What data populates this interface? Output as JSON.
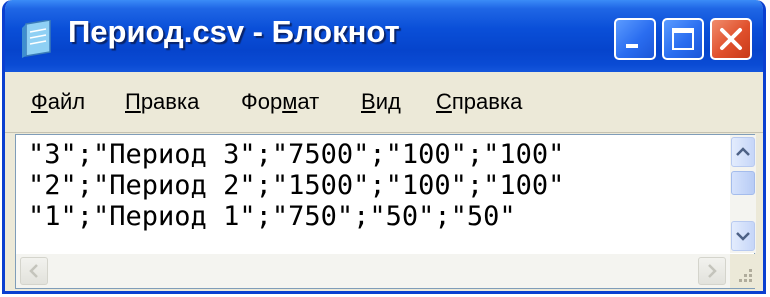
{
  "window": {
    "title": "Период.csv - Блокнот",
    "icon": "notepad-icon"
  },
  "titlebar_buttons": {
    "minimize": "minimize-icon",
    "maximize": "maximize-icon",
    "close": "close-icon"
  },
  "menu": {
    "items": [
      {
        "accel": "Ф",
        "rest": "айл"
      },
      {
        "accel": "П",
        "rest": "равка"
      },
      {
        "pre": "Фор",
        "accel": "м",
        "rest": "ат"
      },
      {
        "accel": "В",
        "rest": "ид"
      },
      {
        "accel": "С",
        "rest": "правка"
      }
    ]
  },
  "editor": {
    "lines": [
      "\"3\";\"Период 3\";\"7500\";\"100\";\"100\"",
      "\"2\";\"Период 2\";\"1500\";\"100\";\"100\"",
      "\"1\";\"Период 1\";\"750\";\"50\";\"50\""
    ]
  },
  "colors": {
    "titlebar": "#0a4fd8",
    "close_button": "#e0502c",
    "window_frame": "#ece9d8"
  }
}
